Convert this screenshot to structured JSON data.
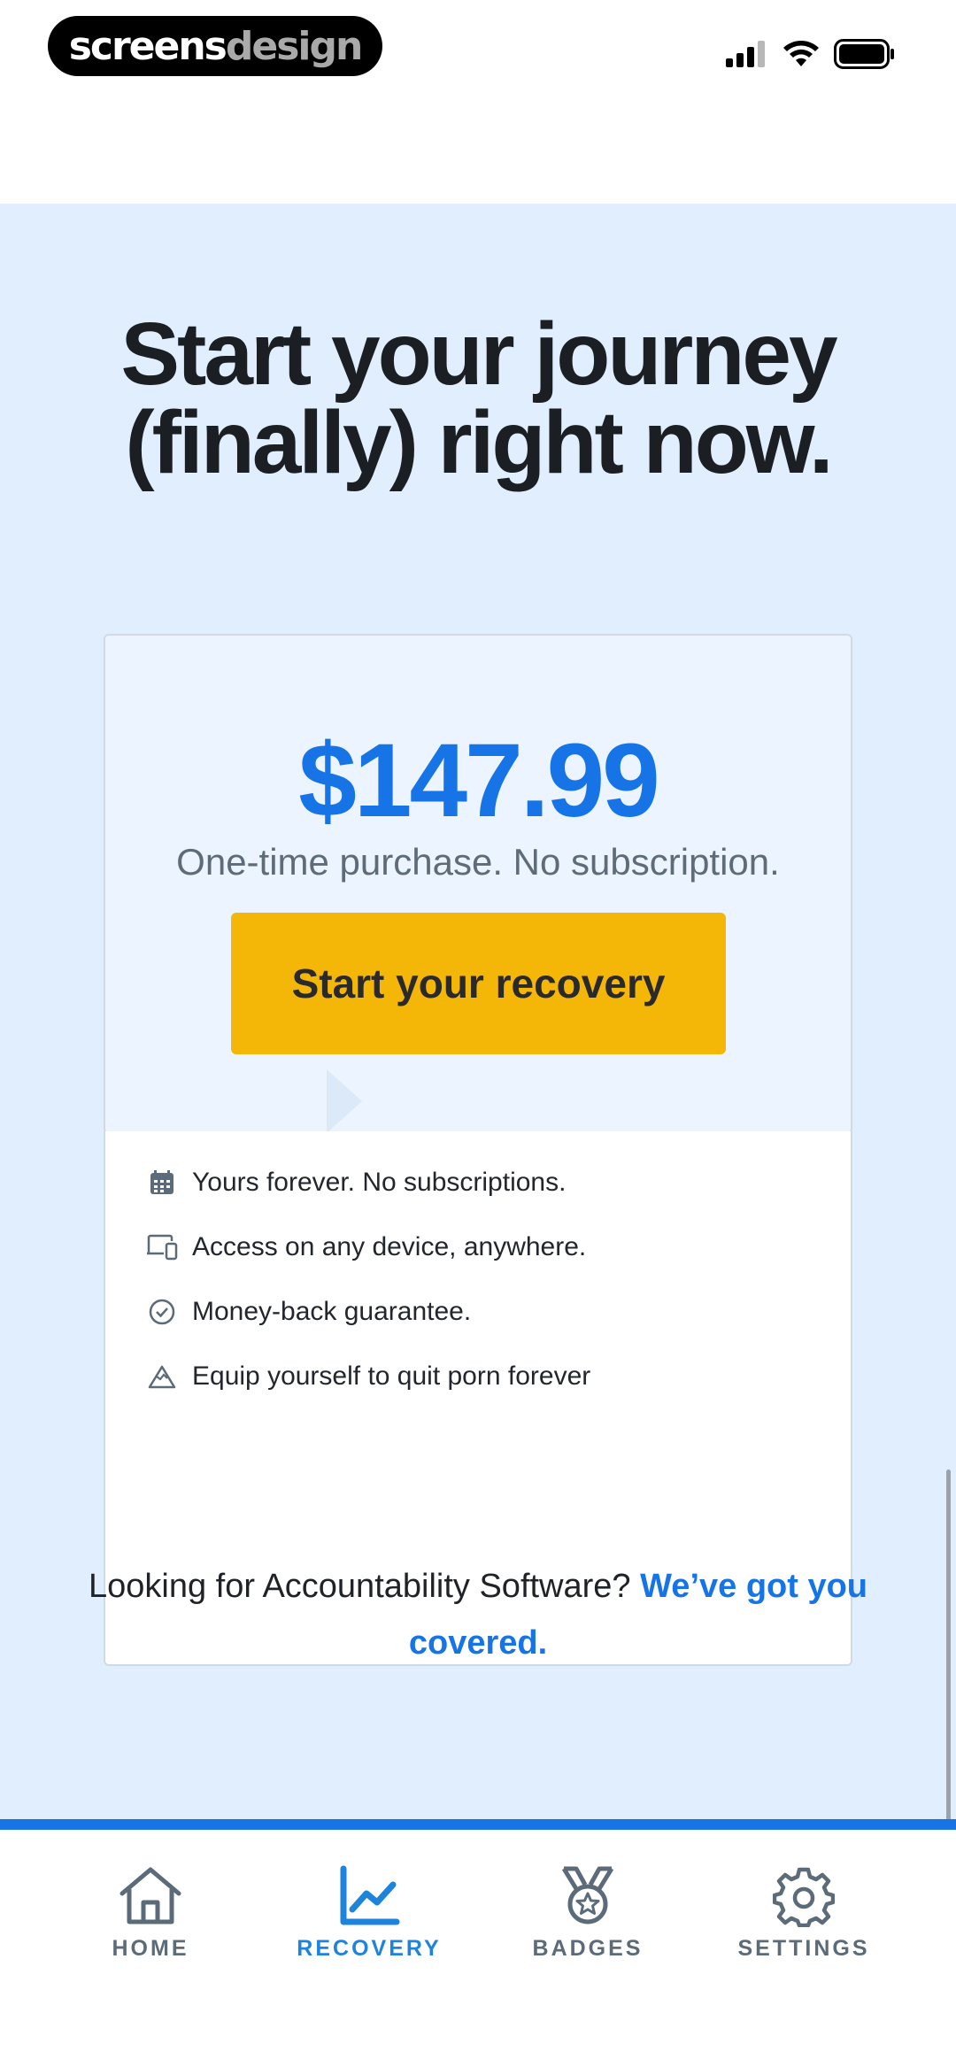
{
  "status_bar": {
    "brand_part1": "screens",
    "brand_part2": "design"
  },
  "headline": {
    "line1": "Start your journey",
    "line2": "(finally) right now."
  },
  "pricing_card": {
    "price": "$147.99",
    "note": "One-time purchase. No subscription.",
    "cta_label": "Start your recovery"
  },
  "features": [
    {
      "icon": "calendar-icon",
      "text": "Yours forever. No subscriptions."
    },
    {
      "icon": "devices-icon",
      "text": "Access on any device, anywhere."
    },
    {
      "icon": "check-circle-icon",
      "text": "Money-back guarantee."
    },
    {
      "icon": "mountain-icon",
      "text": "Equip yourself to quit porn forever"
    }
  ],
  "footer": {
    "prompt": "Looking for Accountability Software?",
    "link": "We’ve got you covered."
  },
  "tabs": [
    {
      "label": "HOME",
      "icon": "home-icon",
      "active": false
    },
    {
      "label": "RECOVERY",
      "icon": "chart-icon",
      "active": true
    },
    {
      "label": "BADGES",
      "icon": "medal-icon",
      "active": false
    },
    {
      "label": "SETTINGS",
      "icon": "gear-icon",
      "active": false
    }
  ],
  "colors": {
    "accent_blue": "#1774e6",
    "cta_yellow": "#f4b607",
    "background_blue": "#e1eefd"
  }
}
